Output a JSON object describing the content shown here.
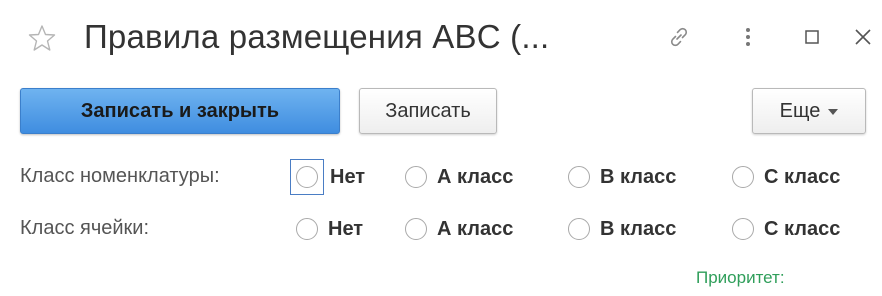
{
  "window": {
    "title": "Правила размещения ABC (..."
  },
  "toolbar": {
    "save_close_label": "Записать и закрыть",
    "save_label": "Записать",
    "more_label": "Еще"
  },
  "form": {
    "nomenclature_class": {
      "label": "Класс номенклатуры:",
      "options": [
        "Нет",
        "А класс",
        "В класс",
        "С класс"
      ],
      "selected": null
    },
    "cell_class": {
      "label": "Класс ячейки:",
      "options": [
        "Нет",
        "А класс",
        "В класс",
        "С класс"
      ],
      "selected": null
    },
    "priority_label": "Приоритет:"
  },
  "colors": {
    "primary_button": "#4a96e6",
    "focus_border": "#4a7dc4",
    "priority_text": "#2f9e5a"
  },
  "icons": [
    "star-icon",
    "link-icon",
    "more-vertical-icon",
    "maximize-icon",
    "close-icon"
  ]
}
